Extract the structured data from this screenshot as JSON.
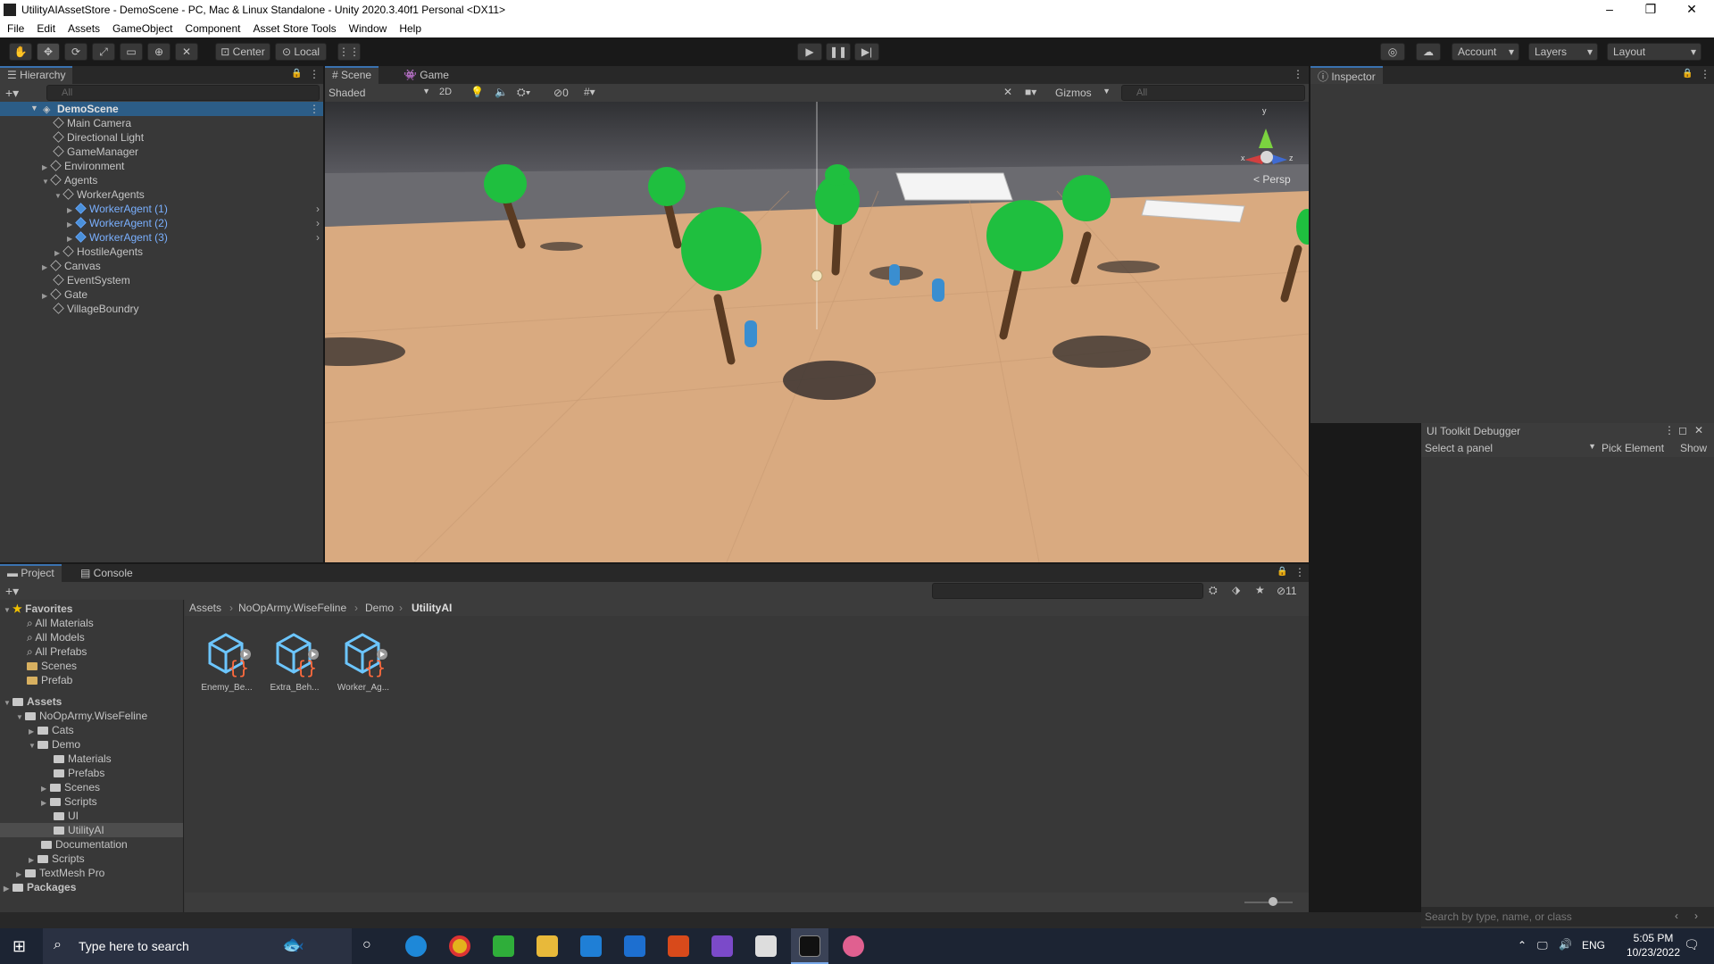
{
  "window": {
    "title": "UtilityAIAssetStore - DemoScene - PC, Mac & Linux Standalone - Unity 2020.3.40f1 Personal <DX11>",
    "minimize": "–",
    "restore": "❐",
    "close": "✕"
  },
  "menu": [
    "File",
    "Edit",
    "Assets",
    "GameObject",
    "Component",
    "Asset Store Tools",
    "Window",
    "Help"
  ],
  "toolbar": {
    "pivot_label": "Center",
    "space_label": "Local",
    "account_label": "Account",
    "layers_label": "Layers",
    "layout_label": "Layout"
  },
  "hierarchy": {
    "tab_label": "Hierarchy",
    "search_placeholder": "All",
    "scene_name": "DemoScene",
    "items": [
      {
        "label": "Main Camera"
      },
      {
        "label": "Directional Light"
      },
      {
        "label": "GameManager"
      },
      {
        "label": "Environment"
      },
      {
        "label": "Agents"
      },
      {
        "label": "WorkerAgents"
      },
      {
        "label": "WorkerAgent (1)"
      },
      {
        "label": "WorkerAgent (2)"
      },
      {
        "label": "WorkerAgent (3)"
      },
      {
        "label": "HostileAgents"
      },
      {
        "label": "Canvas"
      },
      {
        "label": "EventSystem"
      },
      {
        "label": "Gate"
      },
      {
        "label": "VillageBoundry"
      }
    ]
  },
  "scene_view": {
    "tabs": [
      "Scene",
      "Game"
    ],
    "shading_mode": "Shaded",
    "mode_2d": "2D",
    "hidden_count": "0",
    "gizmos_label": "Gizmos",
    "search_placeholder": "All",
    "persp_label": "Persp",
    "axis_x": "x",
    "axis_y": "y",
    "axis_z": "z"
  },
  "inspector": {
    "tab_label": "Inspector"
  },
  "ui_toolkit_debugger": {
    "title": "UI Toolkit Debugger",
    "select_panel": "Select a panel",
    "pick_element": "Pick Element",
    "show": "Show",
    "search_placeholder": "Search by type, name, or class"
  },
  "project": {
    "tabs": [
      "Project",
      "Console"
    ],
    "hidden_count": "11",
    "favorites_label": "Favorites",
    "favorites": [
      "All Materials",
      "All Models",
      "All Prefabs",
      "Scenes",
      "Prefab"
    ],
    "assets_label": "Assets",
    "tree": [
      "NoOpArmy.WiseFeline",
      "Cats",
      "Demo",
      "Materials",
      "Prefabs",
      "Scenes",
      "Scripts",
      "UI",
      "UtilityAI",
      "Documentation",
      "Scripts",
      "TextMesh Pro"
    ],
    "packages_label": "Packages",
    "breadcrumb": [
      "Assets",
      "NoOpArmy.WiseFeline",
      "Demo",
      "UtilityAI"
    ],
    "assets": [
      "Enemy_Be...",
      "Extra_Beh...",
      "Worker_Ag..."
    ]
  },
  "taskbar": {
    "search_placeholder": "Type here to search",
    "lang": "ENG",
    "time": "5:05 PM",
    "date": "10/23/2022"
  },
  "colors": {
    "selection": "#2c5d87",
    "accent_blue": "#3a72b0",
    "tree_green": "#1fbf3f",
    "ground": "#d9aa80"
  }
}
